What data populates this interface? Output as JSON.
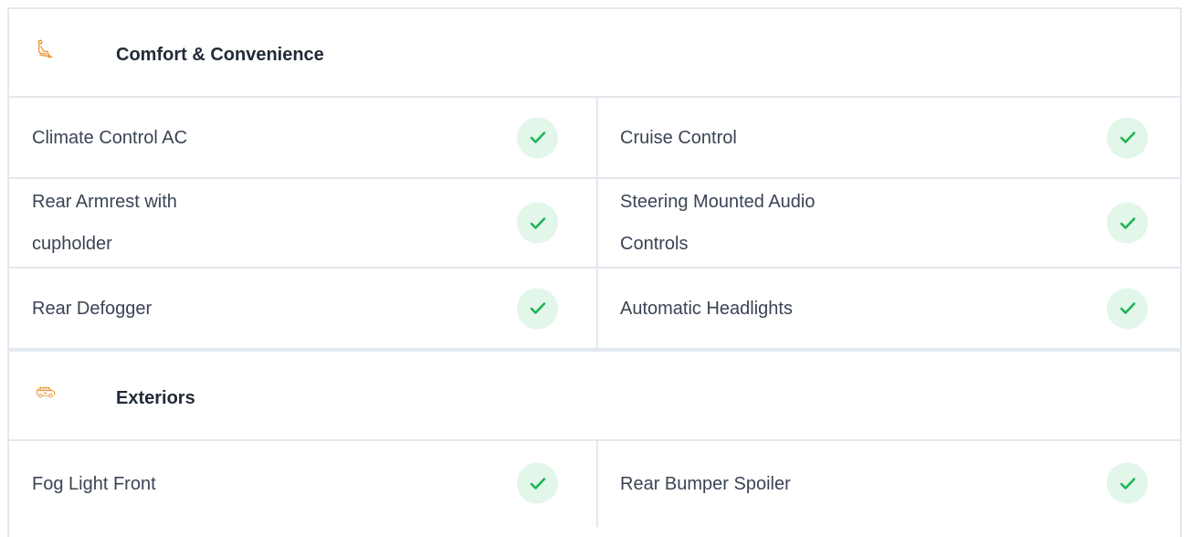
{
  "sections": [
    {
      "title": "Comfort & Convenience",
      "icon": "seat-icon",
      "rows": [
        {
          "left": "Climate Control AC",
          "right": "Cruise Control"
        },
        {
          "left": "Rear Armrest with cupholder",
          "right": "Steering Mounted Audio Controls"
        },
        {
          "left": "Rear Defogger",
          "right": "Automatic Headlights"
        }
      ]
    },
    {
      "title": "Exteriors",
      "icon": "car-icon",
      "rows": [
        {
          "left": "Fog Light Front",
          "right": "Rear Bumper Spoiler"
        }
      ]
    }
  ],
  "colors": {
    "check_green": "#1fb457",
    "check_bg": "#e3f6ea",
    "icon_orange": "#e8902a",
    "border": "#e3e8ee"
  }
}
